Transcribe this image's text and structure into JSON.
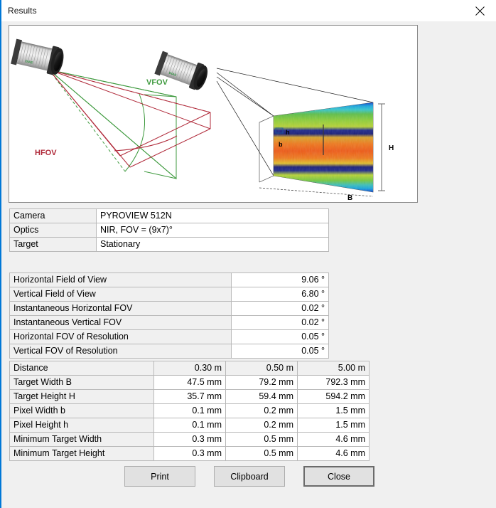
{
  "window": {
    "title": "Results",
    "close_icon": "close-icon",
    "accent_color": "#0078d7"
  },
  "diagram": {
    "labels": {
      "vfov": "VFOV",
      "hfov": "HFOV",
      "target_width": "B",
      "target_height": "H",
      "pixel_width": "b",
      "pixel_height": "h"
    },
    "colors": {
      "vfov": "#3f9a3f",
      "hfov": "#b02a3a",
      "camera_body": "#cfcfcf",
      "camera_cap": "#3a3a3a",
      "lens": "#1b1b1b"
    }
  },
  "info_table": {
    "rows": [
      {
        "label": "Camera",
        "value": "PYROVIEW 512N"
      },
      {
        "label": "Optics",
        "value": "NIR, FOV = (9x7)°"
      },
      {
        "label": "Target",
        "value": "Stationary"
      }
    ]
  },
  "fov_table": {
    "rows": [
      {
        "label": "Horizontal Field of View",
        "value": "9.06 °"
      },
      {
        "label": "Vertical Field of View",
        "value": "6.80 °"
      },
      {
        "label": "Instantaneous Horizontal FOV",
        "value": "0.02 °"
      },
      {
        "label": "Instantaneous Vertical FOV",
        "value": "0.02 °"
      },
      {
        "label": "Horizontal FOV of Resolution",
        "value": "0.05 °"
      },
      {
        "label": "Vertical FOV of Resolution",
        "value": "0.05 °"
      }
    ]
  },
  "distance_table": {
    "header": {
      "label": "Distance",
      "c1": "0.30 m",
      "c2": "0.50 m",
      "c3": "5.00 m"
    },
    "rows": [
      {
        "label": "Target Width B",
        "c1": "47.5 mm",
        "c2": "79.2 mm",
        "c3": "792.3 mm"
      },
      {
        "label": "Target Height H",
        "c1": "35.7 mm",
        "c2": "59.4 mm",
        "c3": "594.2 mm"
      },
      {
        "label": "Pixel Width b",
        "c1": "0.1 mm",
        "c2": "0.2 mm",
        "c3": "1.5 mm"
      },
      {
        "label": "Pixel Height h",
        "c1": "0.1 mm",
        "c2": "0.2 mm",
        "c3": "1.5 mm"
      },
      {
        "label": "Minimum Target Width",
        "c1": "0.3 mm",
        "c2": "0.5 mm",
        "c3": "4.6 mm"
      },
      {
        "label": "Minimum Target Height",
        "c1": "0.3 mm",
        "c2": "0.5 mm",
        "c3": "4.6 mm"
      }
    ]
  },
  "buttons": {
    "print": "Print",
    "clipboard": "Clipboard",
    "close": "Close"
  }
}
